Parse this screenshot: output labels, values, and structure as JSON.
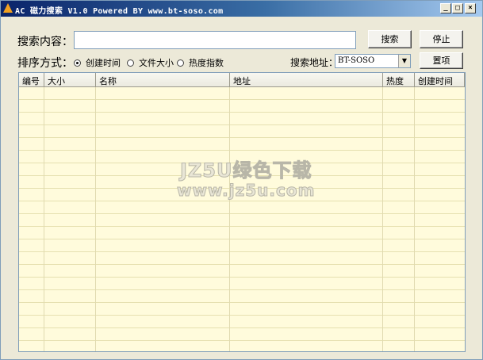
{
  "window": {
    "title": "AC 磁力搜索 V1.0 Powered BY www.bt-soso.com",
    "min": "_",
    "max": "□",
    "close": "×"
  },
  "search": {
    "label": "搜索内容：",
    "value": "",
    "search_button": "搜索",
    "stop_button": "停止"
  },
  "sort": {
    "label": "排序方式：",
    "options": [
      {
        "label": "创建时间",
        "selected": true
      },
      {
        "label": "文件大小",
        "selected": false
      },
      {
        "label": "热度指数",
        "selected": false
      }
    ]
  },
  "address": {
    "label": "搜索地址：",
    "selected": "BT-SOSO",
    "settings_button": "置项"
  },
  "table": {
    "columns": [
      "编号",
      "大小",
      "名称",
      "地址",
      "热度",
      "创建时间"
    ],
    "rows": []
  },
  "watermark": {
    "line1": "JZ5U绿色下载",
    "line2": "www.jz5u.com"
  },
  "colors": {
    "grid_bg": "#fffbdc",
    "title_start": "#0a246a",
    "title_end": "#a6caf0"
  }
}
